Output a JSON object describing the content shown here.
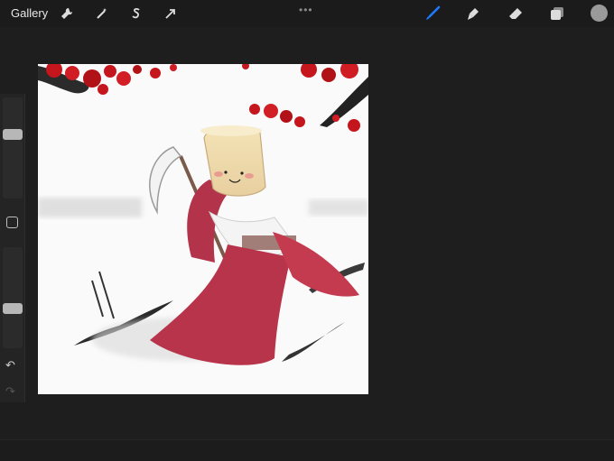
{
  "toolbar": {
    "gallery_label": "Gallery",
    "left_tools": [
      "wrench-icon",
      "magic-wand-icon",
      "selection-s-icon",
      "transform-arrow-icon"
    ],
    "right_tools": [
      "brush-icon",
      "smudge-icon",
      "eraser-icon",
      "layers-icon"
    ],
    "active_tool": "brush-icon",
    "more_label": "•••"
  },
  "colors": {
    "accent": "#1e7bff",
    "current_color": "#9a9a9a"
  },
  "sidebar": {
    "brush_size_level": 0.35,
    "opacity_level": 0.62,
    "undo_symbol": "↶",
    "redo_symbol": "↷"
  },
  "canvas": {
    "image_semantic": "watercolor-illustration"
  }
}
